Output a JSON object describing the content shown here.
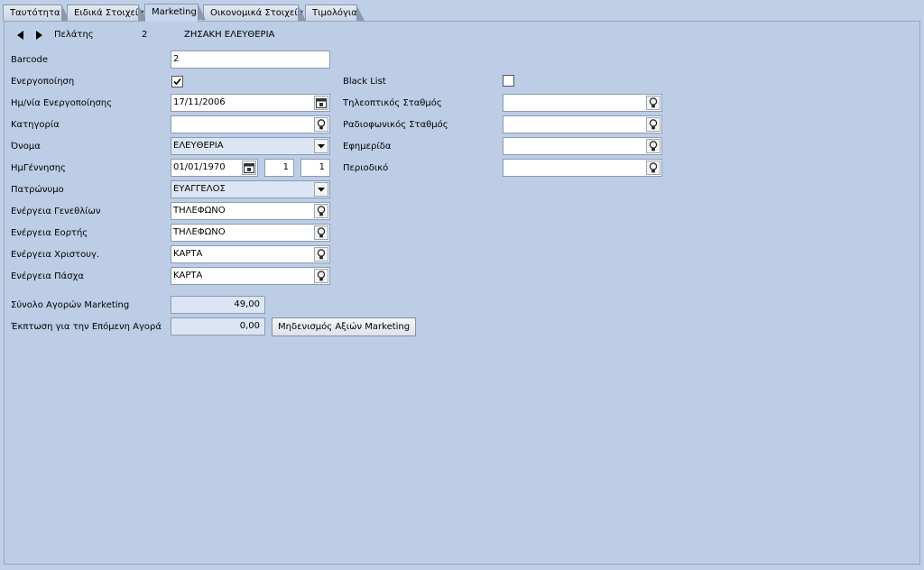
{
  "tabs": [
    {
      "label": "Ταυτότητα",
      "active": false
    },
    {
      "label": "Ειδικά Στοιχεία",
      "active": false
    },
    {
      "label": "Marketing",
      "active": true
    },
    {
      "label": "Οικονομικά Στοιχεία",
      "active": false
    },
    {
      "label": "Τιμολόγια",
      "active": false
    }
  ],
  "navigator": {
    "label": "Πελάτης",
    "id": "2",
    "name": "ΖΗΣΑΚΗ ΕΛΕΥΘΕΡΙΑ"
  },
  "left": {
    "barcode_label": "Barcode",
    "barcode_value": "2",
    "activation_label": "Ενεργοποίηση",
    "activation_checked": true,
    "activation_date_label": "Ημ/νία Ενεργοποίησης",
    "activation_date_value": "17/11/2006",
    "category_label": "Κατηγορία",
    "category_value": "",
    "name_label": "Όνομα",
    "name_value": "ΕΛΕΥΘΕΡΙΑ",
    "birthdate_label": "ΗμΓέννησης",
    "birthdate_value": "01/01/1970",
    "birth_day": "1",
    "birth_month": "1",
    "patronymic_label": "Πατρώνυμο",
    "patronymic_value": "ΕΥΑΓΓΕΛΟΣ",
    "birthday_action_label": "Ενέργεια Γενεθλίων",
    "birthday_action_value": "ΤΗΛΕΦΩΝΟ",
    "nameday_action_label": "Ενέργεια Εορτής",
    "nameday_action_value": "ΤΗΛΕΦΩΝΟ",
    "christmas_action_label": "Ενέργεια Χριστουγ.",
    "christmas_action_value": "ΚΑΡΤΑ",
    "easter_action_label": "Ενέργεια Πάσχα",
    "easter_action_value": "ΚΑΡΤΑ"
  },
  "right": {
    "blacklist_label": "Black List",
    "blacklist_checked": false,
    "tv_label": "Τηλεοπτικός Σταθμός",
    "tv_value": "",
    "radio_label": "Ραδιοφωνικός Σταθμός",
    "radio_value": "",
    "newspaper_label": "Εφημερίδα",
    "newspaper_value": "",
    "magazine_label": "Περιοδικό",
    "magazine_value": ""
  },
  "totals": {
    "purchases_label": "Σύνολο Αγορών Marketing",
    "purchases_value": "49,00",
    "discount_label": "Έκπτωση για την Επόμενη Αγορά",
    "discount_value": "0,00",
    "reset_button": "Μηδενισμός Αξιών Marketing"
  },
  "icons": {
    "lookup": "lightbulb-icon",
    "calendar": "calendar-icon",
    "dropdown": "chevron-down-icon",
    "prev": "prev-arrow-icon",
    "next": "next-arrow-icon",
    "check": "checkmark-icon"
  },
  "colors": {
    "background": "#bfcfe6",
    "panel": "#bdcde6",
    "readonly": "#dce5f3"
  }
}
